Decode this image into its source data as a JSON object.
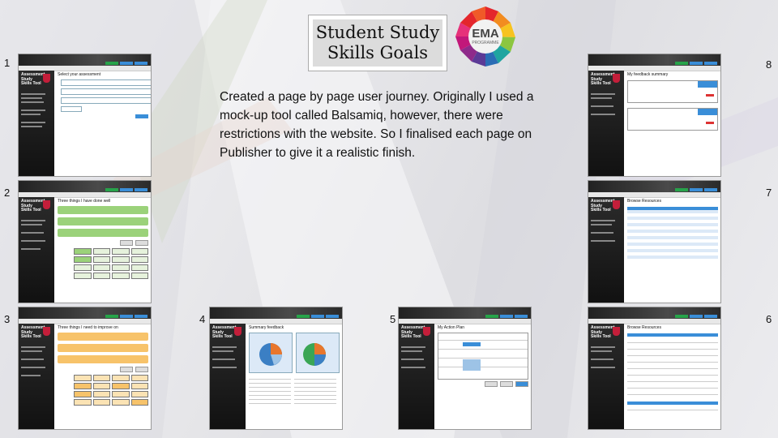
{
  "title": {
    "line1": "Student Study",
    "line2": "Skills Goals"
  },
  "logo": {
    "text": "EMA",
    "subtext": "PROGRAMME",
    "icon": "ema-programme-logo"
  },
  "description": "Created a page by page user journey. Originally I used a mock-up tool called Balsamiq, however, there were restrictions with the website. So I finalised each page on Publisher to give it a realistic finish.",
  "numbers": [
    "1",
    "2",
    "3",
    "4",
    "5",
    "6",
    "7",
    "8"
  ],
  "screens": {
    "s1": {
      "app": "Assessment Study Skills Tool",
      "heading": "Select your assessment"
    },
    "s2": {
      "app": "Assessment Study Skills Tool",
      "heading": "Three things I have done well"
    },
    "s3": {
      "app": "Assessment Study Skills Tool",
      "heading": "Three things I need to improve on"
    },
    "s4": {
      "app": "Assessment Study Skills Tool",
      "heading": "Summary feedback"
    },
    "s5": {
      "app": "Assessment Study Skills Tool",
      "heading": "My Action Plan"
    },
    "s6": {
      "app": "Assessment Study Skills Tool",
      "heading": "Browse Resources"
    },
    "s7": {
      "app": "Assessment Study Skills Tool",
      "heading": "Browse Resources"
    },
    "s8": {
      "app": "Assessment Study Skills Tool",
      "heading": "My feedback summary"
    }
  },
  "colors": {
    "accent": "#3a8ed8",
    "green": "#9bd27a",
    "orange": "#f7c36a",
    "blue_pie": "#3b7fc4",
    "orange_pie": "#e8762c",
    "green_pie": "#3aa655"
  }
}
